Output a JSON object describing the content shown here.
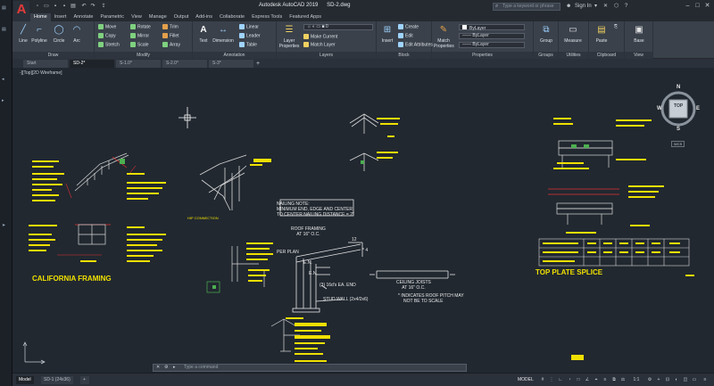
{
  "window": {
    "app_title": "Autodesk AutoCAD 2019",
    "file_name": "SD-2.dwg",
    "search_placeholder": "Type a keyword or phrase",
    "user": "Sign In"
  },
  "tabs": [
    "Home",
    "Insert",
    "Annotate",
    "Parametric",
    "View",
    "Manage",
    "Output",
    "Add-ins",
    "Collaborate",
    "Express Tools",
    "Featured Apps"
  ],
  "active_tab": "Home",
  "ribbon": {
    "draw": {
      "title": "Draw",
      "line": "Line",
      "polyline": "Polyline",
      "circle": "Circle",
      "arc": "Arc"
    },
    "modify": {
      "title": "Modify",
      "move": "Move",
      "rotate": "Rotate",
      "trim": "Trim",
      "copy": "Copy",
      "mirror": "Mirror",
      "fillet": "Fillet",
      "stretch": "Stretch",
      "scale": "Scale",
      "array": "Array"
    },
    "annotation": {
      "title": "Annotation",
      "text": "Text",
      "dimension": "Dimension",
      "linear": "Linear",
      "leader": "Leader",
      "table": "Table"
    },
    "layers": {
      "title": "Layers",
      "layer_properties": "Layer Properties",
      "make_current": "Make Current",
      "match_layer": "Match Layer"
    },
    "block": {
      "title": "Block",
      "insert": "Insert",
      "create": "Create",
      "edit": "Edit",
      "edit_attributes": "Edit Attributes"
    },
    "properties": {
      "title": "Properties",
      "match_properties": "Match Properties",
      "color": "ByLayer",
      "lineweight": "ByLayer",
      "linetype": "ByLayer"
    },
    "groups": {
      "title": "Groups",
      "group": "Group"
    },
    "utilities": {
      "title": "Utilities",
      "measure": "Measure"
    },
    "clipboard": {
      "title": "Clipboard",
      "paste": "Paste"
    },
    "view": {
      "title": "View",
      "base": "Base"
    }
  },
  "doc_tabs": [
    "Start",
    "SD-2*",
    "S-1.0*",
    "S-2.0*",
    "S-3*"
  ],
  "active_doc_tab": "SD-2*",
  "viewport_controls": "-][Top][2D Wireframe]",
  "viewcube": {
    "face": "TOP",
    "n": "N",
    "s": "S",
    "e": "E",
    "w": "W",
    "wcs": "WCS"
  },
  "drawing": {
    "nailing_note_1": "NAILING NOTE:",
    "nailing_note_2": "MINIMUM END, EDGE AND CENTER",
    "nailing_note_3": "TO CENTER NAILING DISTANCE = 2\"",
    "roof_framing_1": "ROOF FRAMING",
    "roof_framing_2": "AT 16\" O.C.",
    "per_plan": "PER PLAN",
    "en_1": "E.N.",
    "en_2": "E.N.",
    "pitch": "12",
    "pitch_star": "* 4",
    "sixteen_d": "(3) 16d's EA. END",
    "stud_wall": "STUD WALL (2x4/2x6)",
    "ceiling_1": "CEILING JOISTS",
    "ceiling_2": "AT 16\" O.C.",
    "indicates_1": "* INDICATES ROOF PITCH MAY",
    "indicates_2": "NOT BE TO SCALE",
    "california_framing": "CALIFORNIA FRAMING",
    "top_plate_splice": "TOP PLATE SPLICE",
    "hip_connection": "HIP CONNECTION"
  },
  "command_line": {
    "placeholder": "Type a command"
  },
  "status": {
    "layout_tabs": [
      "Model",
      "SD-1 (24x36)"
    ],
    "active_layout": "Model",
    "model_label": "MODEL",
    "scale": "1:1"
  }
}
